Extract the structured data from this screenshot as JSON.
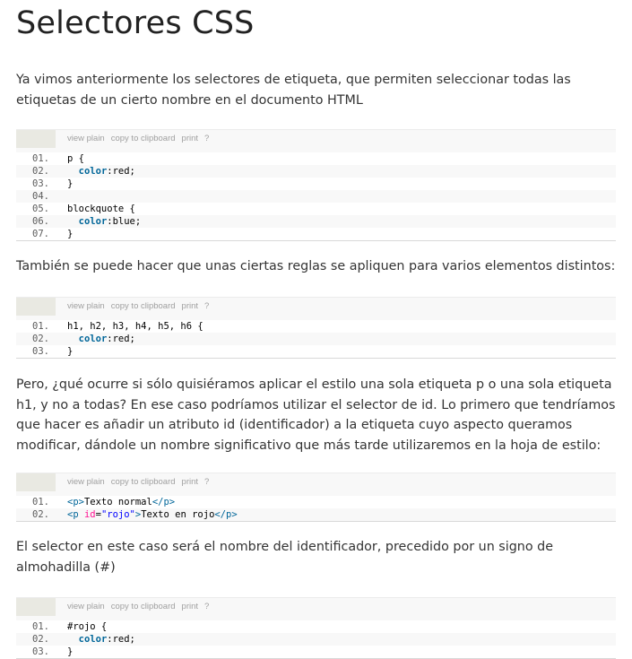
{
  "title": "Selectores CSS",
  "paragraphs": {
    "p1": "Ya vimos anteriormente los selectores de etiqueta, que permiten seleccionar todas las etiquetas de un cierto nombre en el documento HTML",
    "p2": "También se puede hacer que unas ciertas reglas se apliquen para varios elementos distintos:",
    "p3": "Pero, ¿qué ocurre si sólo quisiéramos aplicar el estilo una sola etiqueta p o una sola etiqueta h1, y no a todas? En ese caso podríamos utilizar el selector de id. Lo primero que tendríamos que hacer es añadir un atributo id (identificador) a la etiqueta cuyo aspecto queramos modificar, dándole un nombre significativo que más tarde utilizaremos en la hoja de estilo:",
    "p4": "El selector en este caso será el nombre del identificador, precedido por un signo de almohadilla (#)"
  },
  "toolbar": {
    "view_plain": "view plain",
    "copy": "copy to clipboard",
    "print": "print",
    "help": "?"
  },
  "code_blocks": [
    {
      "lines": [
        {
          "num": "01.",
          "parts": [
            {
              "t": "p {",
              "c": ""
            }
          ]
        },
        {
          "num": "02.",
          "parts": [
            {
              "t": "  ",
              "c": ""
            },
            {
              "t": "color",
              "c": "kw"
            },
            {
              "t": ":red;",
              "c": ""
            }
          ]
        },
        {
          "num": "03.",
          "parts": [
            {
              "t": "}",
              "c": ""
            }
          ]
        },
        {
          "num": "04.",
          "parts": [
            {
              "t": "",
              "c": ""
            }
          ]
        },
        {
          "num": "05.",
          "parts": [
            {
              "t": "blockquote {",
              "c": ""
            }
          ]
        },
        {
          "num": "06.",
          "parts": [
            {
              "t": "  ",
              "c": ""
            },
            {
              "t": "color",
              "c": "kw"
            },
            {
              "t": ":blue;",
              "c": ""
            }
          ]
        },
        {
          "num": "07.",
          "parts": [
            {
              "t": "}",
              "c": ""
            }
          ]
        }
      ]
    },
    {
      "lines": [
        {
          "num": "01.",
          "parts": [
            {
              "t": "h1, h2, h3, h4, h5, h6 {",
              "c": ""
            }
          ]
        },
        {
          "num": "02.",
          "parts": [
            {
              "t": "  ",
              "c": ""
            },
            {
              "t": "color",
              "c": "kw"
            },
            {
              "t": ":red;",
              "c": ""
            }
          ]
        },
        {
          "num": "03.",
          "parts": [
            {
              "t": "}",
              "c": ""
            }
          ]
        }
      ]
    },
    {
      "lines": [
        {
          "num": "01.",
          "parts": [
            {
              "t": "<p>",
              "c": "tag"
            },
            {
              "t": "Texto normal",
              "c": ""
            },
            {
              "t": "</p>",
              "c": "tag"
            }
          ]
        },
        {
          "num": "02.",
          "parts": [
            {
              "t": "<p ",
              "c": "tag"
            },
            {
              "t": "id",
              "c": "attr"
            },
            {
              "t": "=",
              "c": ""
            },
            {
              "t": "\"rojo\"",
              "c": "str"
            },
            {
              "t": ">",
              "c": "tag"
            },
            {
              "t": "Texto en rojo",
              "c": ""
            },
            {
              "t": "</p>",
              "c": "tag"
            }
          ]
        }
      ]
    },
    {
      "lines": [
        {
          "num": "01.",
          "parts": [
            {
              "t": "#rojo {",
              "c": ""
            }
          ]
        },
        {
          "num": "02.",
          "parts": [
            {
              "t": "  ",
              "c": ""
            },
            {
              "t": "color",
              "c": "kw"
            },
            {
              "t": ":red;",
              "c": ""
            }
          ]
        },
        {
          "num": "03.",
          "parts": [
            {
              "t": "}",
              "c": ""
            }
          ]
        }
      ]
    }
  ],
  "colors": {
    "gutter_bar": "#6ce26c",
    "keyword": "#006699",
    "attribute": "#ff1493",
    "string": "#0000ff"
  }
}
